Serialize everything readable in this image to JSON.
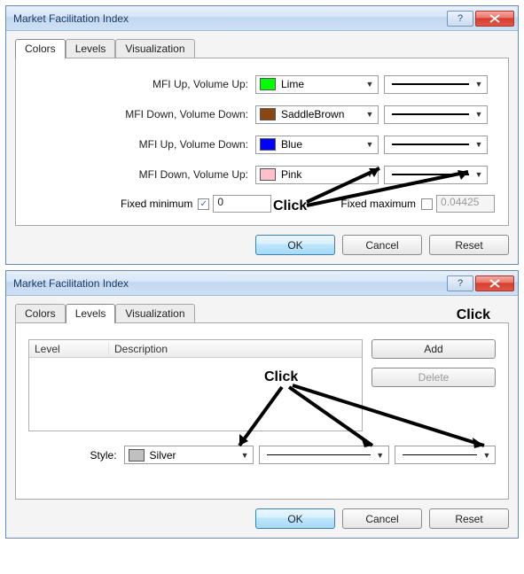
{
  "dialog1": {
    "title": "Market Facilitation Index",
    "tabs": {
      "colors": "Colors",
      "levels": "Levels",
      "visualization": "Visualization"
    },
    "rows": [
      {
        "label": "MFI Up, Volume Up:",
        "color_name": "Lime",
        "color_hex": "#00ff00"
      },
      {
        "label": "MFI Down, Volume Down:",
        "color_name": "SaddleBrown",
        "color_hex": "#8b4513"
      },
      {
        "label": "MFI Up, Volume Down:",
        "color_name": "Blue",
        "color_hex": "#0000ff"
      },
      {
        "label": "MFI Down, Volume Up:",
        "color_name": "Pink",
        "color_hex": "#ffc0cb"
      }
    ],
    "fixed_min_label": "Fixed minimum",
    "fixed_min_checked": true,
    "fixed_min_value": "0",
    "fixed_max_label": "Fixed maximum",
    "fixed_max_checked": false,
    "fixed_max_value": "0.04425",
    "buttons": {
      "ok": "OK",
      "cancel": "Cancel",
      "reset": "Reset"
    },
    "annotation": "Click"
  },
  "dialog2": {
    "title": "Market Facilitation Index",
    "tabs": {
      "colors": "Colors",
      "levels": "Levels",
      "visualization": "Visualization"
    },
    "list_headers": {
      "level": "Level",
      "description": "Description"
    },
    "add": "Add",
    "delete": "Delete",
    "style_label": "Style:",
    "style_color_name": "Silver",
    "style_color_hex": "#c0c0c0",
    "buttons": {
      "ok": "OK",
      "cancel": "Cancel",
      "reset": "Reset"
    },
    "annotation_top": "Click",
    "annotation_mid": "Click"
  }
}
